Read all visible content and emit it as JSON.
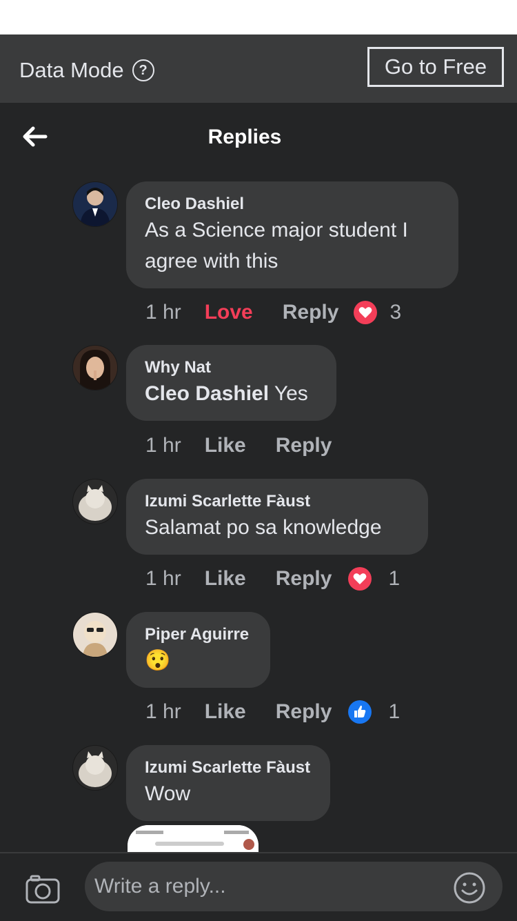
{
  "data_mode": {
    "label": "Data Mode",
    "help_icon": "help-icon",
    "go_free": "Go to Free"
  },
  "header": {
    "title": "Replies",
    "back_icon": "arrow-left-icon"
  },
  "comments": [
    {
      "author": "Cleo Dashiel",
      "text": "As a Science major student I agree with this",
      "time": "1 hr",
      "reaction_label": "Love",
      "reply": "Reply",
      "reaction": "love",
      "count": "3"
    },
    {
      "author": "Why Nat",
      "mention": "Cleo Dashiel",
      "text": "Yes",
      "time": "1 hr",
      "reaction_label": "Like",
      "reply": "Reply"
    },
    {
      "author": "Izumi Scarlette Fàust",
      "text": "Salamat po sa knowledge",
      "time": "1 hr",
      "reaction_label": "Like",
      "reply": "Reply",
      "reaction": "love",
      "count": "1"
    },
    {
      "author": "Piper Aguirre",
      "text": "😯",
      "time": "1 hr",
      "reaction_label": "Like",
      "reply": "Reply",
      "reaction": "like",
      "count": "1"
    },
    {
      "author": "Izumi Scarlette Fàust",
      "text": "Wow"
    }
  ],
  "composer": {
    "placeholder": "Write a reply...",
    "camera_icon": "camera-icon",
    "emoji_icon": "smiley-icon"
  },
  "colors": {
    "love": "#f33e58",
    "like": "#1877f2",
    "bubble": "#3a3b3c",
    "background": "#242526"
  }
}
